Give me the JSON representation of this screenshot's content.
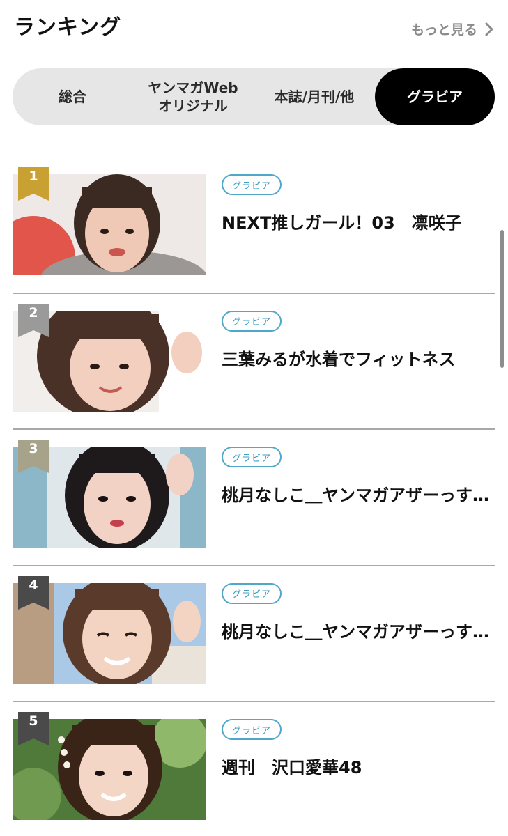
{
  "header": {
    "title": "ランキング",
    "more_label": "もっと見る"
  },
  "tabs": [
    {
      "label": "総合",
      "active": false
    },
    {
      "label": "ヤンマガWeb\nオリジナル",
      "active": false
    },
    {
      "label": "本誌/月刊/他",
      "active": false
    },
    {
      "label": "グラビア",
      "active": true
    }
  ],
  "ranking": [
    {
      "rank": "1",
      "tag": "グラビア",
      "title": "NEXT推しガール！03　凛咲子",
      "badge_color": "#c9a133"
    },
    {
      "rank": "2",
      "tag": "グラビア",
      "title": "三葉みるが水着でフィットネス",
      "badge_color": "#9a9a9a"
    },
    {
      "rank": "3",
      "tag": "グラビア",
      "title": "桃月なしこ＿ヤンマガアザーっす…",
      "badge_color": "#a7a28a"
    },
    {
      "rank": "4",
      "tag": "グラビア",
      "title": "桃月なしこ＿ヤンマガアザーっす…",
      "badge_color": "#4a4a4a"
    },
    {
      "rank": "5",
      "tag": "グラビア",
      "title": "週刊　沢口愛華48",
      "badge_color": "#4a4a4a"
    }
  ],
  "colors": {
    "active_tab_bg": "#000000",
    "tab_bar_bg": "#e6e6e6",
    "tag_border": "#4fa8c9"
  }
}
